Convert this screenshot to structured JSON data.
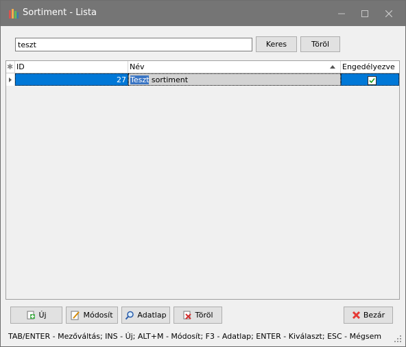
{
  "window": {
    "title": "Sortiment - Lista",
    "titlebar_color": "#757575",
    "icons": [
      "app-icon",
      "minimize-icon",
      "maximize-icon",
      "close-icon"
    ]
  },
  "search": {
    "value": "teszt",
    "search_button": "Keres",
    "clear_button": "Töröl"
  },
  "grid": {
    "columns": [
      {
        "name": "id",
        "label": "ID"
      },
      {
        "name": "name",
        "label": "Név",
        "sort": "ascending"
      },
      {
        "name": "enabled",
        "label": "Engedélyezve"
      }
    ],
    "rows": [
      {
        "id": "27",
        "name_highlight": "Teszt",
        "name_rest": " sortiment",
        "enabled": true
      }
    ],
    "selection_color": "#0078d7"
  },
  "buttons": {
    "new": "Új",
    "modify": "Módosít",
    "datasheet": "Adatlap",
    "delete": "Töröl",
    "close": "Bezár"
  },
  "status_bar": {
    "text": "TAB/ENTER - Mezőváltás; INS - Új; ALT+M - Módosít; F3 - Adatlap; ENTER - Kiválaszt; ESC - Mégsem"
  }
}
